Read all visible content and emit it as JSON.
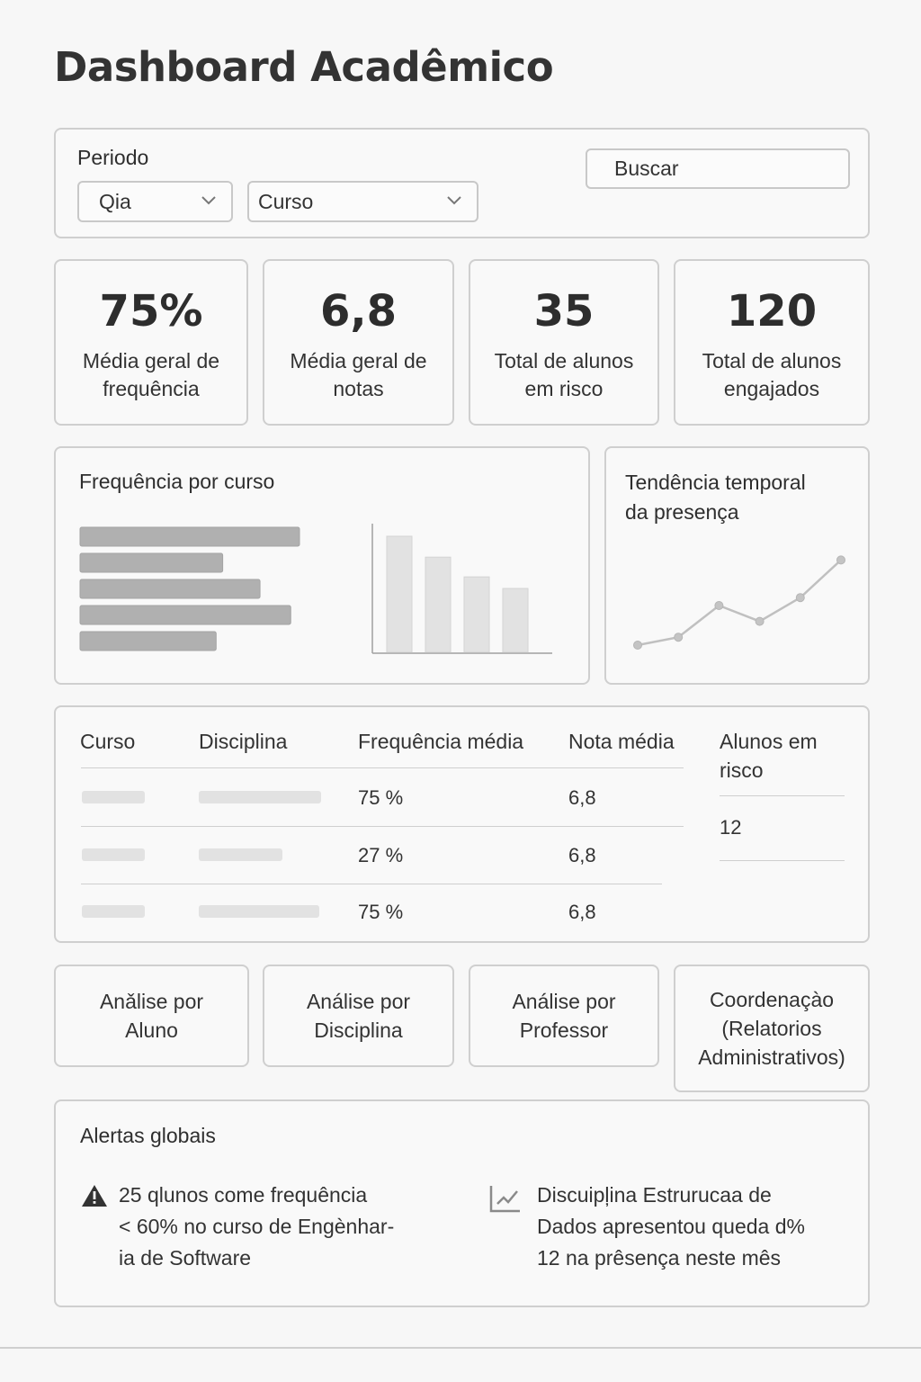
{
  "page_title": "Dashboard Acadêmico",
  "filters": {
    "period_label": "Periodo",
    "period_select_value": "Qia",
    "course_select_value": "Curso",
    "search_button_label": "Buscar"
  },
  "kpis": [
    {
      "value": "75%",
      "label": "Média geral de frequência"
    },
    {
      "value": "6,8",
      "label": "Média geral de notas"
    },
    {
      "value": "35",
      "label": "Total de alunos em risco"
    },
    {
      "value": "120",
      "label": "Total de alunos engajados"
    }
  ],
  "attendance_by_course": {
    "title": "Frequência por curso"
  },
  "attendance_trend": {
    "title_line1": "Tendência temporal",
    "title_line2": "da presença"
  },
  "chart_data": [
    {
      "type": "bar",
      "orientation": "horizontal",
      "title": "Frequência por curso",
      "series": [
        {
          "values": [
            100,
            65,
            82,
            96,
            62
          ]
        }
      ]
    },
    {
      "type": "bar",
      "orientation": "vertical",
      "series": [
        {
          "values": [
            100,
            82,
            65,
            55
          ]
        }
      ]
    },
    {
      "type": "line",
      "title": "Tendência temporal da presença",
      "x": [
        1,
        2,
        3,
        4,
        5,
        6
      ],
      "series": [
        {
          "values": [
            10,
            18,
            50,
            34,
            58,
            96
          ]
        }
      ],
      "grid": false
    }
  ],
  "table": {
    "headers": {
      "course": "Curso",
      "discipline": "Disciplina",
      "avg_attendance": "Frequência média",
      "avg_grade": "Nota média",
      "at_risk": "Alunos em risco"
    },
    "rows": [
      {
        "attendance": "75 %",
        "grade": "6,8"
      },
      {
        "attendance": "27 %",
        "grade": "6,8"
      },
      {
        "attendance": "75 %",
        "grade": "6,8"
      }
    ],
    "at_risk_value": "12"
  },
  "navigation": {
    "by_student": "Anǎlise por\nAluno",
    "by_discipline": "Análise por\nDisciplina",
    "by_professor": "Análise por\nProfessor",
    "coordination": "Coordenaçào\n(Relatorios\nAdministrativos)"
  },
  "alerts": {
    "title": "Alertas globais",
    "items": [
      {
        "icon": "warning-icon",
        "text_lines": [
          "25 qlunos come frequência",
          "< 60% no curso de Engènhar-",
          "ia de Software"
        ]
      },
      {
        "icon": "trend-chart-icon",
        "text_lines": [
          "Discuipļina Estrurucaa de",
          "Dados apresentou queda d%",
          "12 na prêsença neste mês"
        ]
      }
    ]
  },
  "colors": {
    "background": "#f7f7f7",
    "card_border": "#cfcfcf",
    "bar_dark": "#b0b0b0",
    "bar_light": "#e2e2e2",
    "line": "#c0c0c0"
  }
}
